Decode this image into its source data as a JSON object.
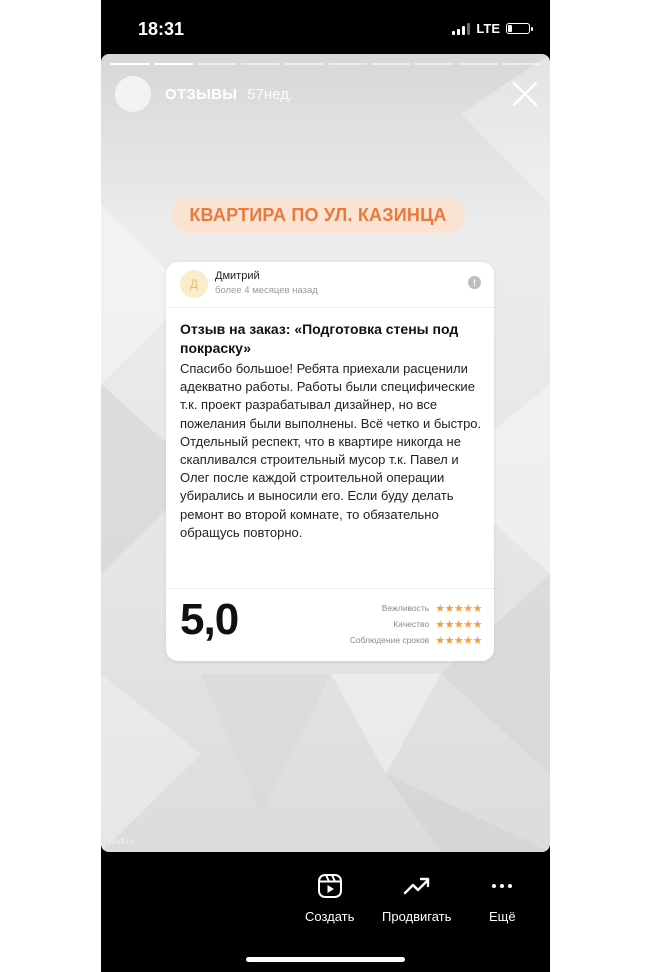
{
  "status_bar": {
    "time": "18:31",
    "network": "LTE"
  },
  "story": {
    "account": "ОТЗЫВЫ",
    "age": "57нед.",
    "watermark": "profi.ru",
    "progress": {
      "segments": 10,
      "current": 2
    }
  },
  "banner": {
    "text": "КВАРТИРА ПО УЛ. КАЗИНЦА"
  },
  "review": {
    "avatar_letter": "Д",
    "author": "Дмитрий",
    "date": "более 4 месяцев назад",
    "title": "Отзыв на заказ: «Подготовка стены под покраску»",
    "text": "Спасибо большое! Ребята приехали расценили адекватно работы. Работы были специфические т.к. проект разрабатывал дизайнер, но все пожелания были выполнены. Всё четко и быстро. Отдельный респект, что в квартире никогда не скапливался строительный мусор т.к. Павел и Олег после каждой строительной операции убирались и выносили его. Если буду делать ремонт во второй комнате, то обязательно обращусь повторно.",
    "score": "5,0",
    "ratings": [
      {
        "label": "Вежливость",
        "stars": 5
      },
      {
        "label": "Качество",
        "stars": 5
      },
      {
        "label": "Соблюдение сроков",
        "stars": 5
      }
    ]
  },
  "actions": [
    {
      "label": "Создать",
      "icon": "reels-icon"
    },
    {
      "label": "Продвигать",
      "icon": "trend-up-icon"
    },
    {
      "label": "Ещё",
      "icon": "more-dots-icon"
    }
  ],
  "colors": {
    "accent": "#e87a3e",
    "pill_bg": "#fbe3d4",
    "stars": "#f0a043"
  }
}
